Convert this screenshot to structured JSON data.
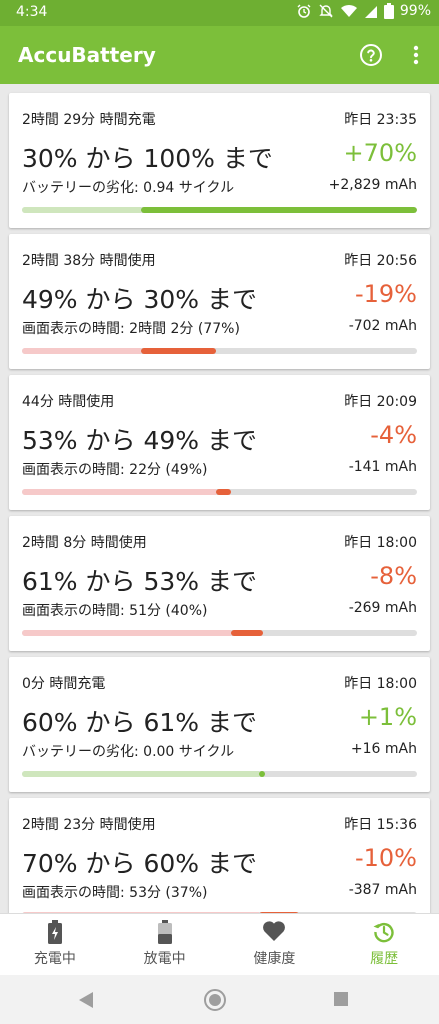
{
  "status_bar": {
    "time": "4:34",
    "battery_percent": "99%"
  },
  "app_bar": {
    "title": "AccuBattery"
  },
  "sessions": [
    {
      "duration": "2時間 29分 時間充電",
      "date": "昨日 23:35",
      "range": "30% から 100% まで",
      "change": "+70%",
      "detail": "バッテリーの劣化: 0.94 サイクル",
      "mah": "+2,829 mAh",
      "kind": "charge",
      "start_pct": 30,
      "end_pct": 100
    },
    {
      "duration": "2時間 38分 時間使用",
      "date": "昨日 20:56",
      "range": "49% から 30% まで",
      "change": "-19%",
      "detail": "画面表示の時間: 2時間 2分 (77%)",
      "mah": "-702 mAh",
      "kind": "discharge",
      "start_pct": 49,
      "end_pct": 30
    },
    {
      "duration": "44分 時間使用",
      "date": "昨日 20:09",
      "range": "53% から 49% まで",
      "change": "-4%",
      "detail": "画面表示の時間: 22分 (49%)",
      "mah": "-141 mAh",
      "kind": "discharge",
      "start_pct": 53,
      "end_pct": 49
    },
    {
      "duration": "2時間 8分 時間使用",
      "date": "昨日 18:00",
      "range": "61% から 53% まで",
      "change": "-8%",
      "detail": "画面表示の時間: 51分 (40%)",
      "mah": "-269 mAh",
      "kind": "discharge",
      "start_pct": 61,
      "end_pct": 53
    },
    {
      "duration": "0分 時間充電",
      "date": "昨日 18:00",
      "range": "60% から 61% まで",
      "change": "+1%",
      "detail": "バッテリーの劣化: 0.00 サイクル",
      "mah": "+16 mAh",
      "kind": "charge",
      "start_pct": 60,
      "end_pct": 61
    },
    {
      "duration": "2時間 23分 時間使用",
      "date": "昨日 15:36",
      "range": "70% から 60% まで",
      "change": "-10%",
      "detail": "画面表示の時間: 53分 (37%)",
      "mah": "-387 mAh",
      "kind": "discharge",
      "start_pct": 70,
      "end_pct": 60
    }
  ],
  "bottom_nav": [
    {
      "label": "充電中",
      "icon": "battery-charging-icon",
      "active": false
    },
    {
      "label": "放電中",
      "icon": "battery-discharging-icon",
      "active": false
    },
    {
      "label": "健康度",
      "icon": "heart-icon",
      "active": false
    },
    {
      "label": "履歴",
      "icon": "history-icon",
      "active": true
    }
  ],
  "colors": {
    "primary": "#7cbf3a",
    "status_bar": "#6eaf32",
    "discharge": "#e6613a",
    "charge_faded": "#cfe6bd",
    "discharge_faded": "#f6c9c9"
  }
}
